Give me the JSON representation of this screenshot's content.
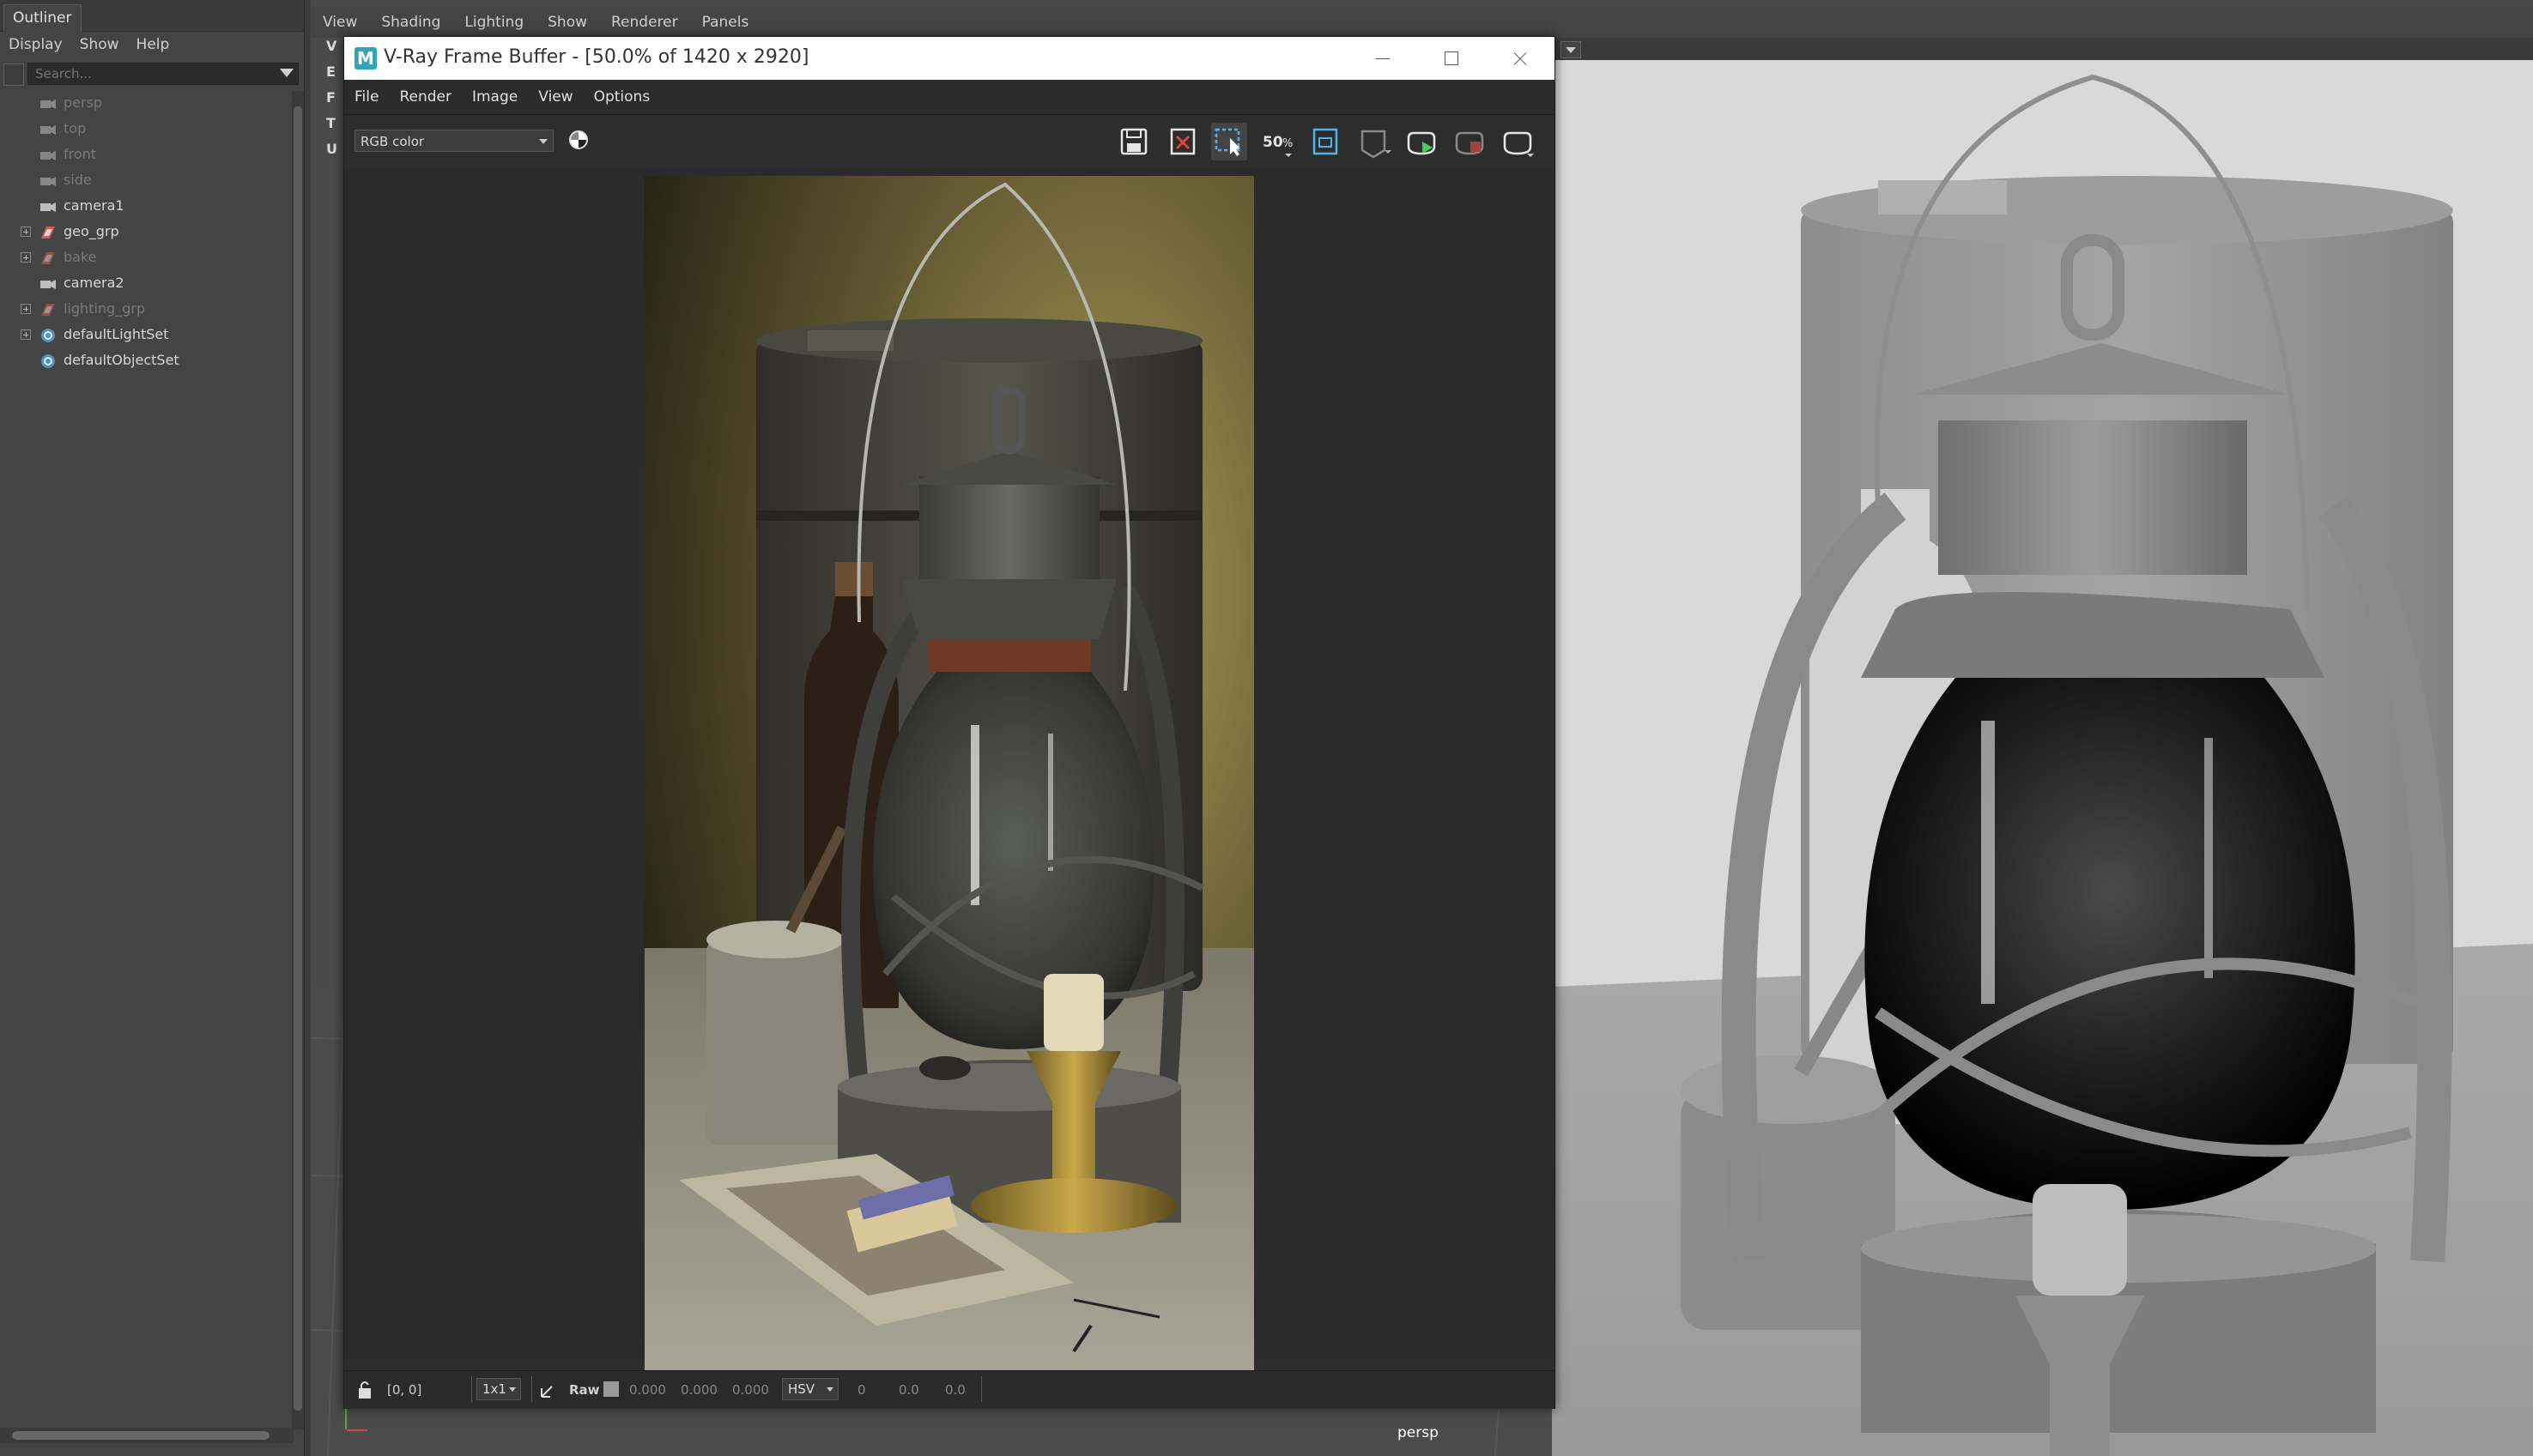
{
  "outliner": {
    "tab_title": "Outliner",
    "menus": [
      "Display",
      "Show",
      "Help"
    ],
    "search_placeholder": "Search...",
    "items": [
      {
        "label": "persp",
        "icon": "camera-icon",
        "dim": true,
        "expandable": false
      },
      {
        "label": "top",
        "icon": "camera-icon",
        "dim": true,
        "expandable": false
      },
      {
        "label": "front",
        "icon": "camera-icon",
        "dim": true,
        "expandable": false
      },
      {
        "label": "side",
        "icon": "camera-icon",
        "dim": true,
        "expandable": false
      },
      {
        "label": "camera1",
        "icon": "camera-icon",
        "dim": false,
        "expandable": false
      },
      {
        "label": "geo_grp",
        "icon": "group-icon",
        "dim": false,
        "expandable": true
      },
      {
        "label": "bake",
        "icon": "group-icon",
        "dim": true,
        "expandable": true
      },
      {
        "label": "camera2",
        "icon": "camera-icon",
        "dim": false,
        "expandable": false
      },
      {
        "label": "lighting_grp",
        "icon": "group-icon",
        "dim": true,
        "expandable": true
      },
      {
        "label": "defaultLightSet",
        "icon": "set-icon",
        "dim": false,
        "expandable": true
      },
      {
        "label": "defaultObjectSet",
        "icon": "set-icon",
        "dim": false,
        "expandable": false
      }
    ]
  },
  "viewport": {
    "menus": [
      "View",
      "Shading",
      "Lighting",
      "Show",
      "Renderer",
      "Panels"
    ],
    "side_letters": [
      "V",
      "E",
      "F",
      "T",
      "U"
    ],
    "camera_label": "persp"
  },
  "vfb": {
    "title": "V-Ray Frame Buffer - [50.0% of 1420 x 2920]",
    "app_icon_letter": "M",
    "menus": [
      "File",
      "Render",
      "Image",
      "View",
      "Options"
    ],
    "channel": "RGB color",
    "toolbar_icons": [
      "save-image-icon",
      "clear-image-icon",
      "region-render-icon",
      "zoom-50-icon",
      "frame-image-icon",
      "track-mouse-icon",
      "render-icon",
      "stop-render-icon",
      "interactive-render-icon"
    ],
    "zoom_badge": "50",
    "status": {
      "coords": "[0, 0]",
      "sample": "1x1",
      "raw_label": "Raw",
      "rgb": [
        "0.000",
        "0.000",
        "0.000"
      ],
      "color_mode": "HSV",
      "hsv": [
        "0",
        "0.0",
        "0.0"
      ]
    }
  },
  "colors": {
    "maya_bg": "#444444",
    "vfb_bg": "#2b2b2b",
    "titlebar": "#ffffff",
    "accent_icon": "#2fa5b8",
    "viewport_scene": "#d9d9d9"
  }
}
